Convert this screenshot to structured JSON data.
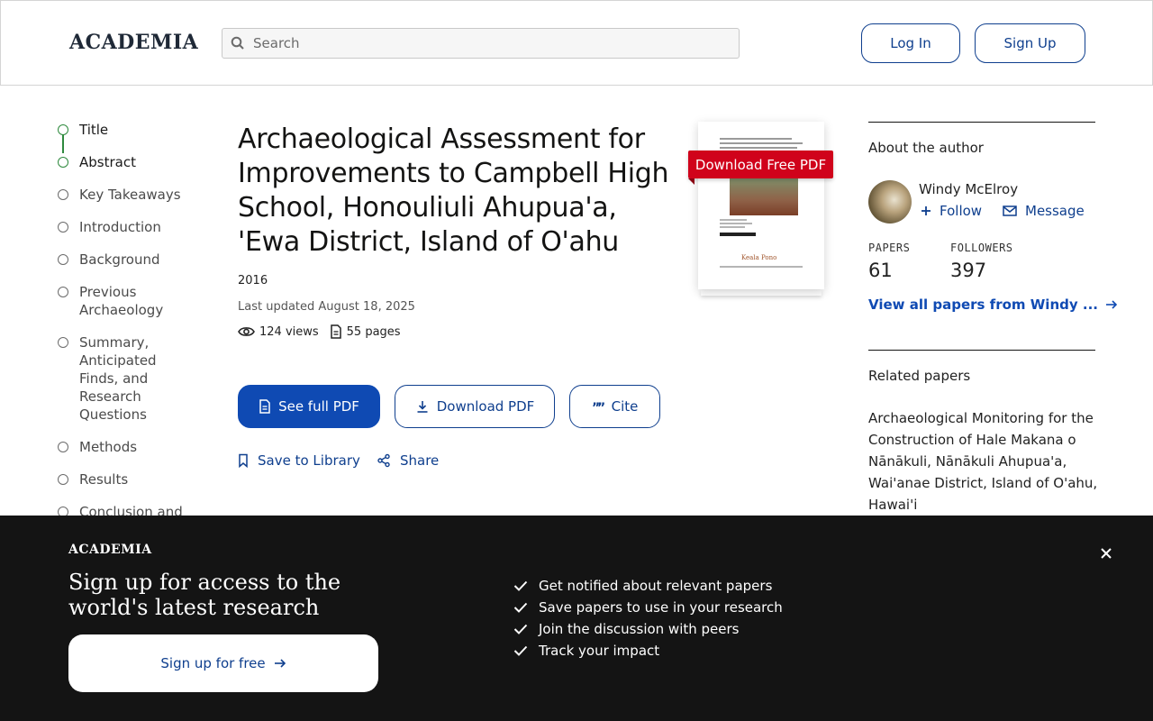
{
  "header": {
    "logo": "ACADEMIA",
    "search_placeholder": "Search",
    "login_label": "Log In",
    "signup_label": "Sign Up"
  },
  "toc": {
    "items": [
      {
        "label": "Title",
        "active": true
      },
      {
        "label": "Abstract",
        "active": true
      },
      {
        "label": "Key Takeaways",
        "active": false
      },
      {
        "label": "Introduction",
        "active": false
      },
      {
        "label": "Background",
        "active": false
      },
      {
        "label": "Previous Archaeology",
        "active": false
      },
      {
        "label": "Summary, Anticipated Finds, and Research Questions",
        "active": false
      },
      {
        "label": "Methods",
        "active": false
      },
      {
        "label": "Results",
        "active": false
      },
      {
        "label": "Conclusion and",
        "active": false
      }
    ]
  },
  "paper": {
    "title": "Archaeological Assessment for Improvements to Campbell High School, Honouliuli Ahupua'a, 'Ewa District, Island of O'ahu",
    "year": "2016",
    "last_updated": "Last updated August 18, 2025",
    "views": "124 views",
    "pages": "55 pages",
    "see_full_pdf": "See full PDF",
    "download_pdf": "Download PDF",
    "cite": "Cite",
    "save_to_library": "Save to Library",
    "share": "Share",
    "thumb_badge": "Download Free PDF",
    "thumb_brand": "Keala Pono"
  },
  "author": {
    "section_title": "About the author",
    "name": "Windy McElroy",
    "follow": "Follow",
    "message": "Message",
    "papers_label": "PAPERS",
    "papers_count": "61",
    "followers_label": "FOLLOWERS",
    "followers_count": "397",
    "view_all": "View all papers from Windy ..."
  },
  "related": {
    "section_title": "Related papers",
    "first_paper": "Archaeological Monitoring for the Construction of Hale Makana o Nānākuli, Nānākuli Ahupua'a, Wai'anae District, Island of O'ahu, Hawai'i"
  },
  "banner": {
    "logo": "ACADEMIA",
    "headline": "Sign up for access to the world's latest research",
    "cta": "Sign up for free",
    "benefits": [
      "Get notified about relevant papers",
      "Save papers to use in your research",
      "Join the discussion with peers",
      "Track your impact"
    ]
  },
  "colors": {
    "accent": "#0f4ab3",
    "link": "#0f3f8e",
    "toc_active": "#2f8a3e",
    "pdf_badge": "#d0021b",
    "banner_bg": "#141414"
  },
  "icons": [
    "search-icon",
    "eye-icon",
    "document-icon",
    "download-icon",
    "quote-icon",
    "bookmark-icon",
    "share-icon",
    "plus-icon",
    "mail-icon",
    "arrow-right-icon",
    "check-icon",
    "close-icon"
  ]
}
